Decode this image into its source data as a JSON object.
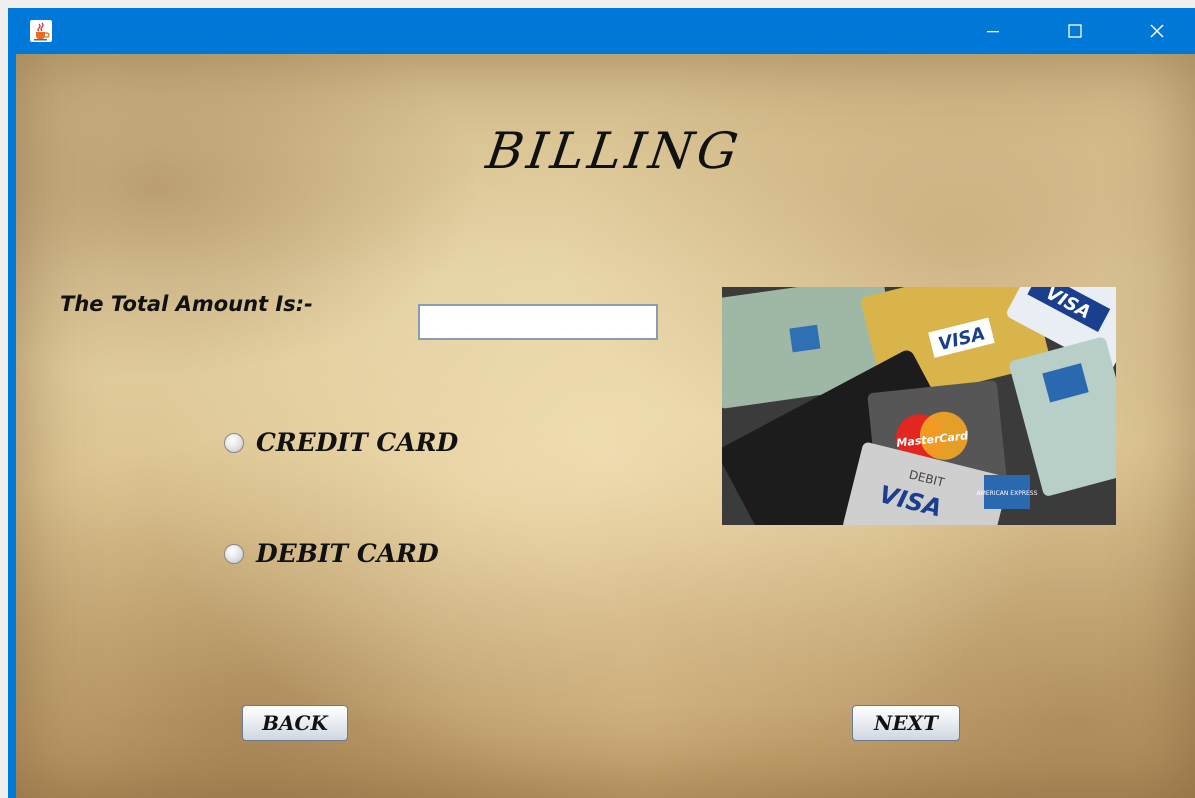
{
  "window": {
    "icon": "java-cup-icon",
    "controls": {
      "minimize": "minimize-icon",
      "maximize": "maximize-icon",
      "close": "close-icon"
    },
    "accent_color": "#0078d7"
  },
  "page": {
    "title": "BILLING",
    "amount_label": "The Total Amount Is:-",
    "amount_value": "",
    "payment_options": [
      {
        "label": "CREDIT CARD",
        "selected": false
      },
      {
        "label": "DEBIT CARD",
        "selected": false
      }
    ],
    "image": {
      "description_icon": "credit-cards-image",
      "visible_text": [
        "VISA",
        "MasterCard",
        "DEBIT",
        "AMERICAN EXPRESS"
      ]
    },
    "buttons": {
      "back": "BACK",
      "next": "NEXT"
    }
  }
}
